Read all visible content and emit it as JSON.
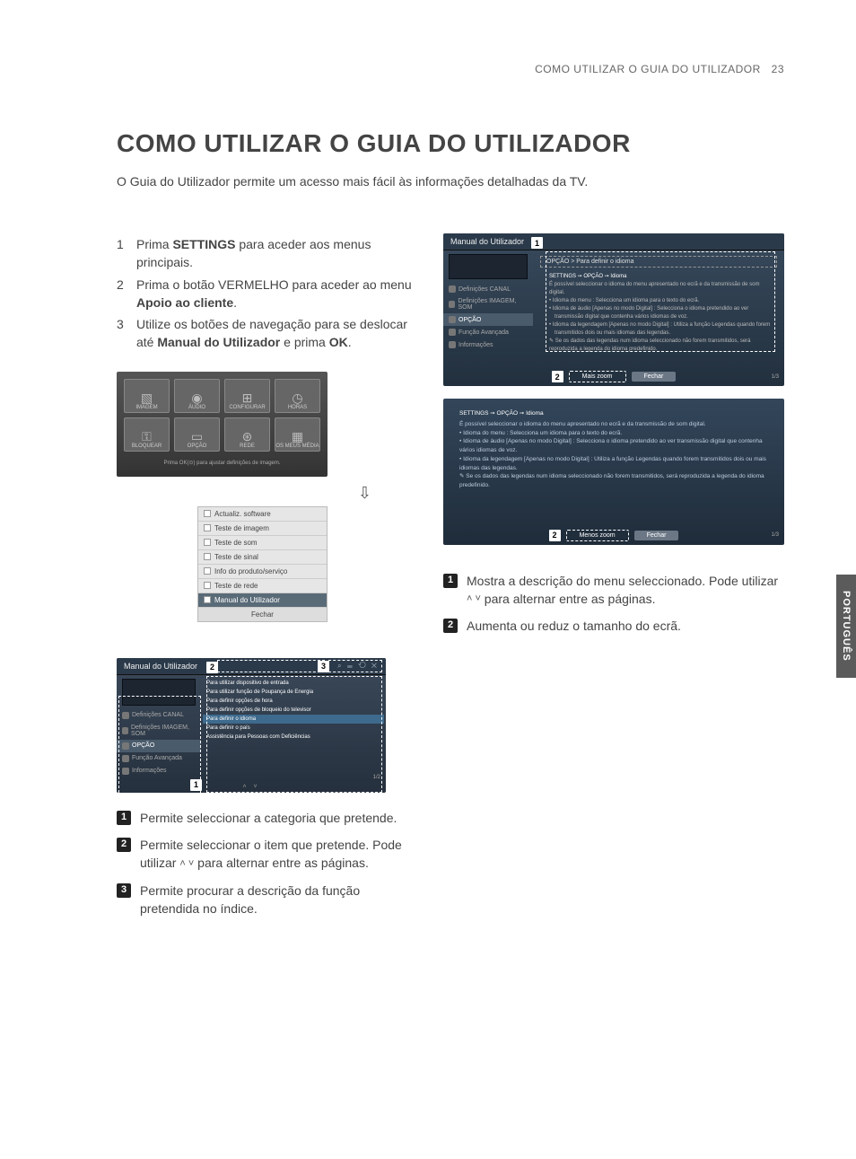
{
  "header": {
    "running": "COMO UTILIZAR O GUIA DO UTILIZADOR",
    "page_num": "23"
  },
  "title": "COMO UTILIZAR O GUIA DO UTILIZADOR",
  "intro": "O Guia do Utilizador permite um acesso mais fácil às informações detalhadas da TV.",
  "lang_tab": "PORTUGUÊS",
  "steps": [
    {
      "n": "1",
      "pre": "Prima ",
      "bold": "SETTINGS",
      "post": " para aceder aos menus principais."
    },
    {
      "n": "2",
      "pre": "Prima o botão VERMELHO para aceder ao menu ",
      "bold": "Apoio ao cliente",
      "post": "."
    },
    {
      "n": "3",
      "pre": "Utilize os botões de navegação para se deslocar até ",
      "bold": "Manual do Utilizador",
      "post": " e prima "
    }
  ],
  "step3_ok": "OK",
  "main_menu": {
    "row1": [
      {
        "icon": "▧",
        "label": "IMAGEM"
      },
      {
        "icon": "◉",
        "label": "ÁUDIO"
      },
      {
        "icon": "⊞",
        "label": "CONFIGURAR"
      },
      {
        "icon": "◷",
        "label": "HORAS"
      }
    ],
    "row2": [
      {
        "icon": "⚿",
        "label": "BLOQUEAR"
      },
      {
        "icon": "▭",
        "label": "OPÇÃO"
      },
      {
        "icon": "⊛",
        "label": "REDE"
      },
      {
        "icon": "▦",
        "label": "OS MEUS MÉDIA"
      }
    ],
    "hint": "Prima OK(⊙) para ajustar definições de imagem."
  },
  "arrow": "⇩",
  "submenu": {
    "items": [
      "Actualiz. software",
      "Teste de imagem",
      "Teste de som",
      "Teste de sinal",
      "Info do produto/serviço",
      "Teste de rede",
      "Manual do Utilizador"
    ],
    "close": "Fechar"
  },
  "guide_shot": {
    "title": "Manual do Utilizador",
    "icons": "⌕ ☰ ⟲ ✕",
    "side": [
      {
        "label": "Definições CANAL"
      },
      {
        "label": "Definições IMAGEM, SOM"
      },
      {
        "label": "OPÇÃO",
        "sel": true
      },
      {
        "label": "Função Avançada"
      },
      {
        "label": "Informações"
      }
    ],
    "topics": [
      "Para utilizar dispositivo de entrada",
      "Para utilizar função de Poupança de Energia",
      "Para definir opções de hora",
      "Para definir opções de bloqueio do televisor",
      "Para definir o idioma",
      "Para definir o país",
      "Assistência para Pessoas com Deficiências"
    ],
    "topics_sel_index": 4,
    "foot": "˄  ˅",
    "pg": "1/2",
    "callouts": {
      "one": "1",
      "two": "2",
      "three": "3"
    }
  },
  "legend_left": [
    {
      "n": "1",
      "text": "Permite seleccionar a categoria que pretende."
    },
    {
      "n": "2",
      "text": "Permite seleccionar o item que pretende. Pode utilizar ",
      "chev": true,
      "tail": " para alternar entre as páginas."
    },
    {
      "n": "3",
      "text": "Permite procurar a descrição da função pretendida no índice."
    }
  ],
  "detail_shot": {
    "title": "Manual do Utilizador",
    "crumb": "OPÇÃO > Para definir o idioma",
    "content_title": "SETTINGS ➙ OPÇÃO ➙ Idioma",
    "content_intro": "É possível seleccionar o idioma do menu apresentado no ecrã e da transmissão de som digital.",
    "bullets": [
      "Idioma do menu : Selecciona um idioma para o texto do ecrã.",
      "Idioma de áudio [Apenas no modo Digital] : Selecciona o idioma pretendido ao ver transmissão digital que contenha vários idiomas de voz.",
      "Idioma da legendagem [Apenas no modo Digital] : Utiliza a função Legendas quando forem transmitidos dois ou mais idiomas das legendas."
    ],
    "note": "✎ Se os dados das legendas num idioma seleccionado não forem transmitidos, será reproduzida a legenda do idioma predefinido.",
    "btn_zoom": "Mais zoom",
    "btn_close": "Fechar",
    "pg": "1/3",
    "callouts": {
      "one": "1",
      "two": "2"
    }
  },
  "zoom_shot": {
    "content_title": "SETTINGS ➙ OPÇÃO ➙ Idioma",
    "content_intro": "É possível seleccionar o idioma do menu apresentado no ecrã e da transmissão de som digital.",
    "bullets": [
      "Idioma do menu : Selecciona um idioma para o texto do ecrã.",
      "Idioma de áudio [Apenas no modo Digital] : Selecciona o idioma pretendido ao ver transmissão digital que contenha vários idiomas de voz.",
      "Idioma da legendagem [Apenas no modo Digital] : Utiliza a função Legendas quando forem transmitidos dois ou mais idiomas das legendas."
    ],
    "note": "✎ Se os dados das legendas num idioma seleccionado não forem transmitidos, será reproduzida a legenda do idioma predefinido.",
    "btn_zoom": "Menos zoom",
    "btn_close": "Fechar",
    "pg": "1/3",
    "callouts": {
      "two": "2"
    }
  },
  "legend_right": [
    {
      "n": "1",
      "text": "Mostra a descrição do menu seleccionado. Pode utilizar ",
      "chev": true,
      "tail": " para alternar entre as páginas."
    },
    {
      "n": "2",
      "text": "Aumenta ou reduz o tamanho do ecrã."
    }
  ],
  "chev_glyphs": "˄ ˅"
}
